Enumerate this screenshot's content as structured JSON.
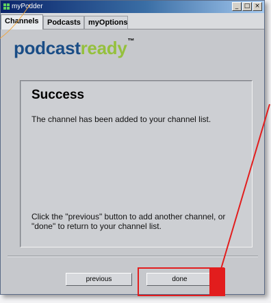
{
  "window": {
    "title": "myPodder",
    "minimize_glyph": "_",
    "maximize_glyph": "□",
    "close_glyph": "×"
  },
  "tabs": [
    {
      "label": "Channels",
      "active": true
    },
    {
      "label": "Podcasts",
      "active": false
    },
    {
      "label": "myOptions",
      "active": false
    }
  ],
  "logo": {
    "part1": "podcast",
    "part2": "ready",
    "trademark": "™"
  },
  "panel": {
    "heading": "Success",
    "message": "The channel has been added to your channel list.",
    "hint": "Click the \"previous\" button to add another channel, or \"done\" to return to your channel list."
  },
  "buttons": {
    "previous": "previous",
    "done": "done"
  },
  "colors": {
    "logo_blue": "#1a4d86",
    "logo_green": "#95c03d",
    "annotation_red": "#e21d1d",
    "titlebar_dark": "#0a246a"
  }
}
